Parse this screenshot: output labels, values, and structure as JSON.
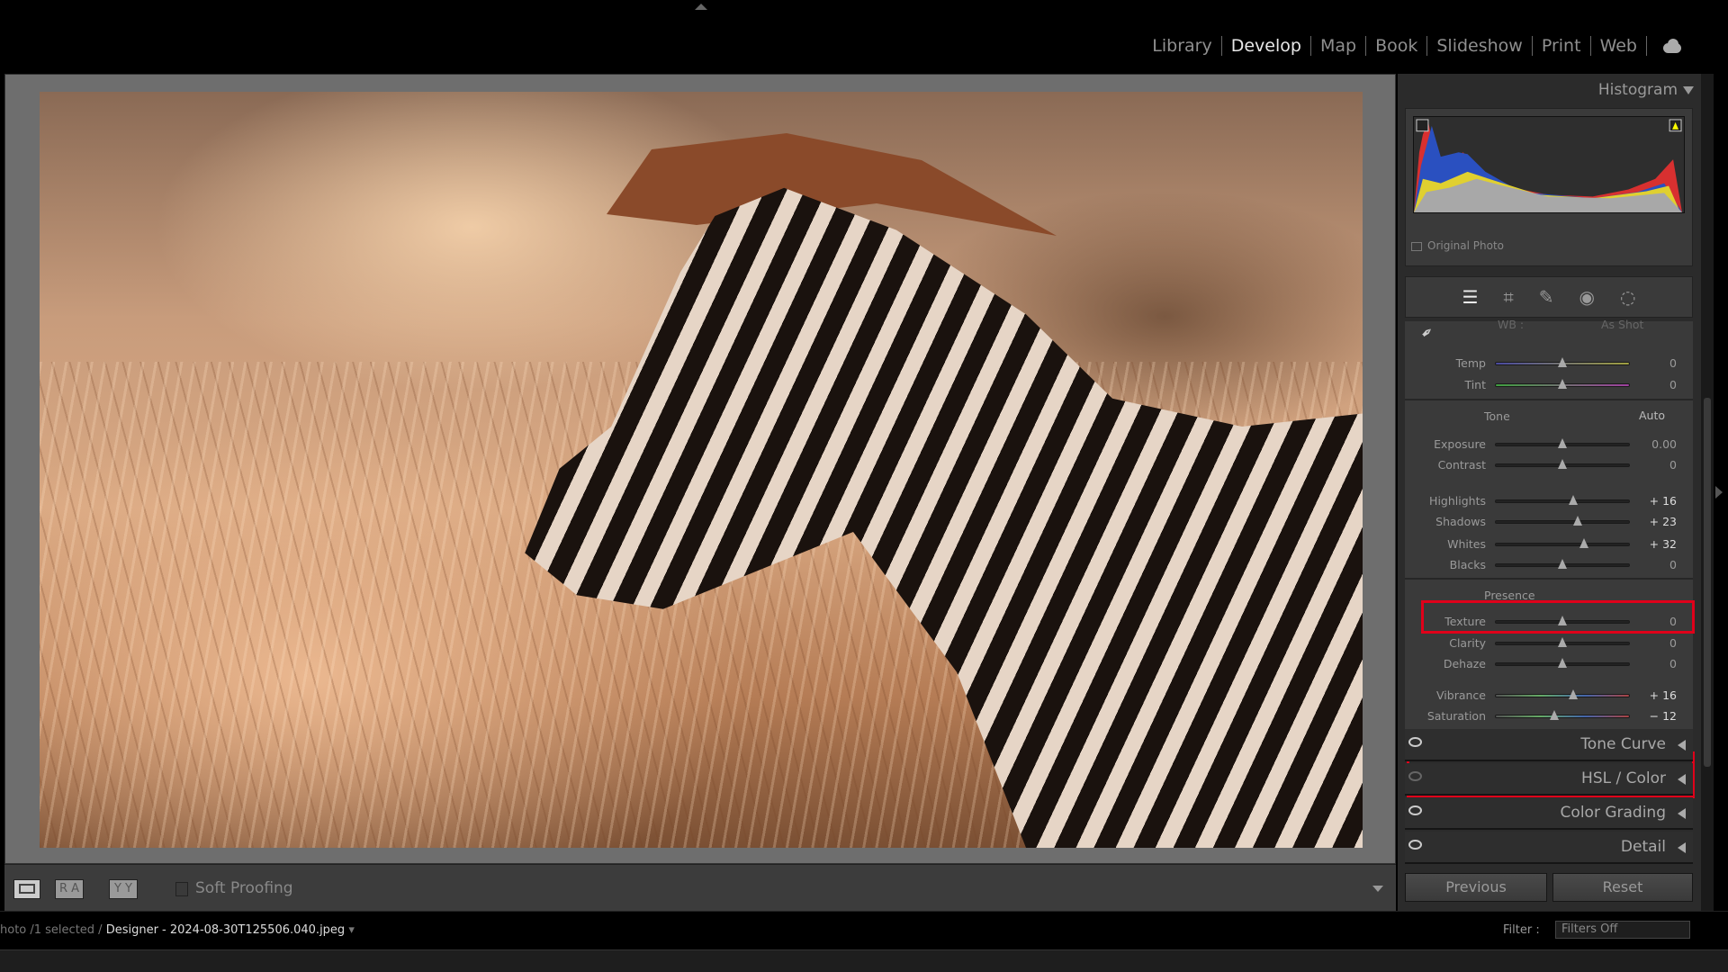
{
  "modules": [
    "Library",
    "Develop",
    "Map",
    "Book",
    "Slideshow",
    "Print",
    "Web"
  ],
  "active_module": "Develop",
  "right_panel": {
    "histogram": {
      "title": "Histogram",
      "original_photo": "Original Photo"
    },
    "tools": [
      "edit-sliders-icon",
      "crop-icon",
      "healing-icon",
      "red-eye-icon",
      "masking-icon"
    ],
    "basic": {
      "wb_label": "WB :",
      "wb_value": "As Shot",
      "wb_sliders": [
        {
          "label": "Temp",
          "value": "0",
          "pos": 0
        },
        {
          "label": "Tint",
          "value": "0",
          "pos": 0
        }
      ],
      "tone_title": "Tone",
      "auto": "Auto",
      "tone_sliders": [
        {
          "label": "Exposure",
          "value": "0.00",
          "pos": 0
        },
        {
          "label": "Contrast",
          "value": "0",
          "pos": 0
        },
        {
          "label": "Highlights",
          "value": "+ 16",
          "pos": 16
        },
        {
          "label": "Shadows",
          "value": "+ 23",
          "pos": 23
        },
        {
          "label": "Whites",
          "value": "+ 32",
          "pos": 32
        },
        {
          "label": "Blacks",
          "value": "0",
          "pos": 0
        }
      ],
      "presence_title": "Presence",
      "presence_sliders": [
        {
          "label": "Texture",
          "value": "0",
          "pos": 0
        },
        {
          "label": "Clarity",
          "value": "0",
          "pos": 0
        },
        {
          "label": "Dehaze",
          "value": "0",
          "pos": 0
        },
        {
          "label": "Vibrance",
          "value": "+ 16",
          "pos": 16
        },
        {
          "label": "Saturation",
          "value": "− 12",
          "pos": -12
        }
      ],
      "highlight_color": "#e0001a"
    },
    "panels": [
      "Tone Curve",
      "HSL / Color",
      "Color Grading",
      "Detail"
    ],
    "previous": "Previous",
    "reset": "Reset"
  },
  "toolbar": {
    "view_a": "R A",
    "view_b": "Y Y",
    "soft_proofing": "Soft Proofing"
  },
  "pathbar": {
    "prefix": "hoto /1 selected /",
    "filename": "Designer - 2024-08-30T125506.040.jpeg",
    "filter_label": "Filter :",
    "filter_value": "Filters Off"
  }
}
